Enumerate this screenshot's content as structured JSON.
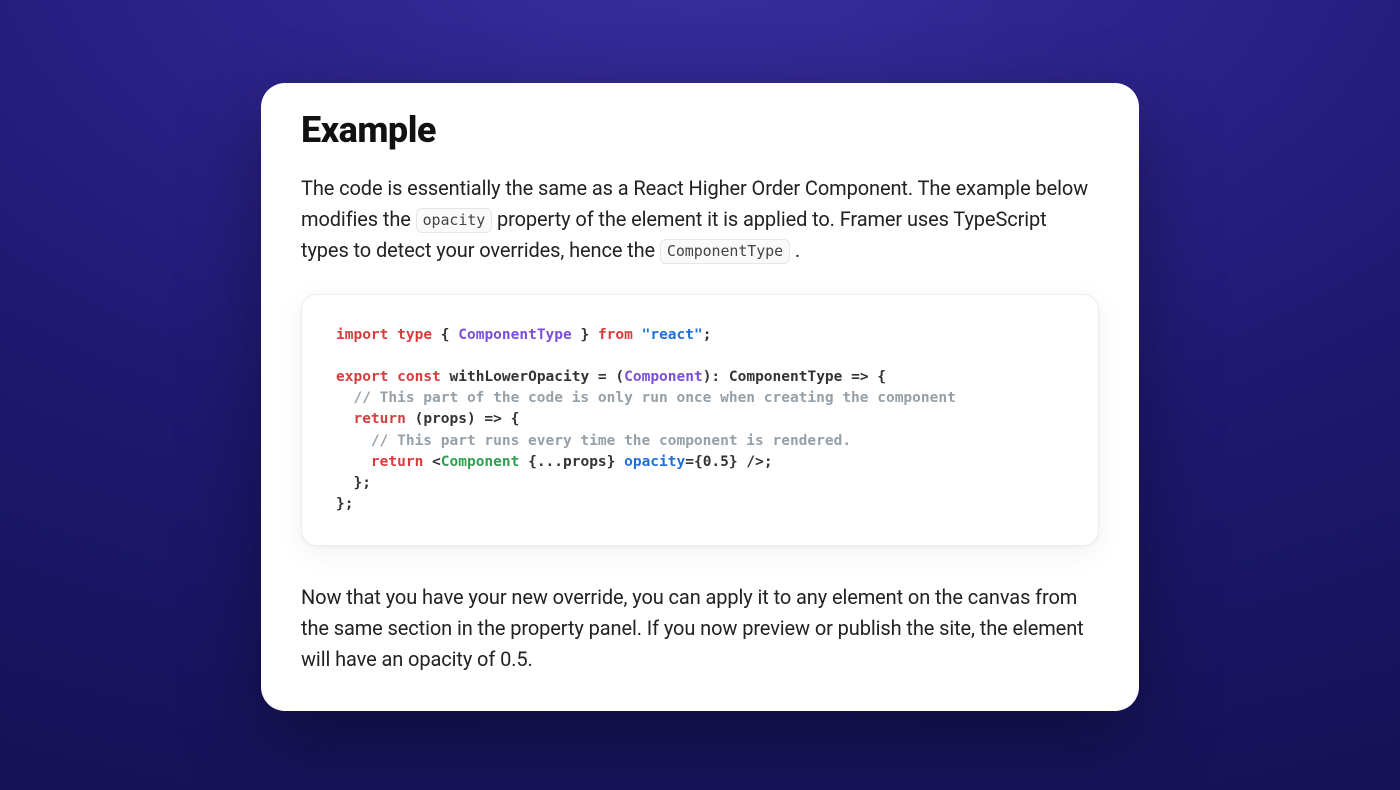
{
  "heading": "Example",
  "para1": {
    "seg1": "The code is essentially the same as a React Higher Order Component. The example below modifies the ",
    "code1": "opacity",
    "seg2": " property of the element it is applied to. Framer uses TypeScript types to detect your overrides, hence the ",
    "code2": "ComponentType",
    "seg3": " ."
  },
  "code": {
    "l1": {
      "import": "import",
      "type": "type",
      "lbrace": "{",
      "ComponentType": "ComponentType",
      "rbrace": "}",
      "from": "from",
      "react": "\"react\"",
      "semi": ";"
    },
    "l3": {
      "export": "export",
      "const": "const",
      "name": "withLowerOpacity",
      "eq": " = (",
      "Component": "Component",
      "after": "): ComponentType => {"
    },
    "l4": "  // This part of the code is only run once when creating the component",
    "l5": {
      "return": "return",
      "rest": " (props) => {"
    },
    "l6": "    // This part runs every time the component is rendered.",
    "l7": {
      "return": "return",
      "lt": " <",
      "Component": "Component",
      "spread": " {...props}",
      "attr": " opacity",
      "val": "={0.5}",
      "end": " />;"
    },
    "l8": "  };",
    "l9": "};"
  },
  "para2": "Now that you have your new override, you can apply it to any element on the canvas from the same section in the property panel. If you now preview or publish the site, the element will have an opacity of 0.5."
}
